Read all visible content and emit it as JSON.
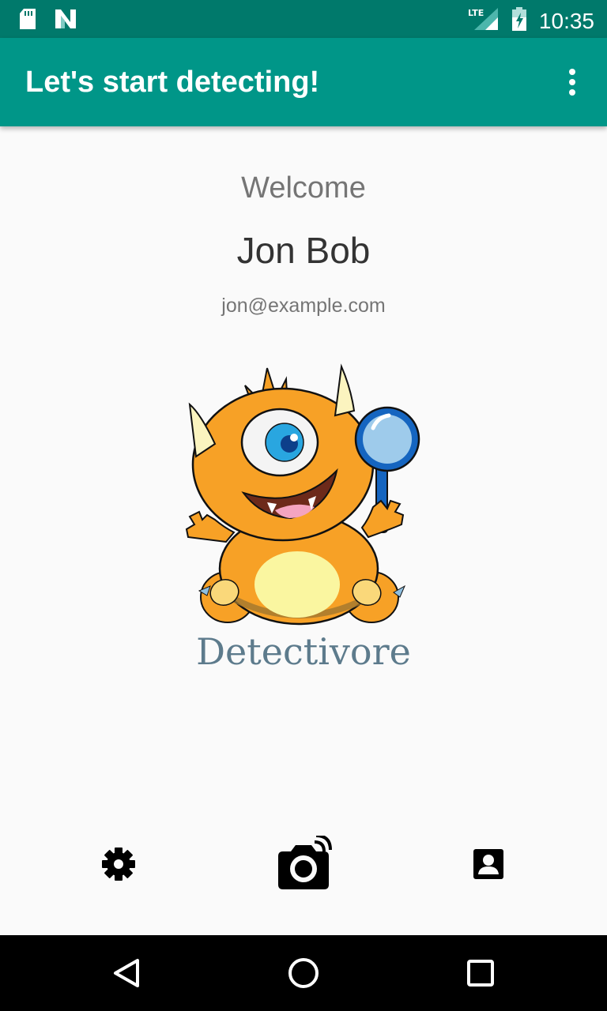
{
  "status_bar": {
    "time": "10:35",
    "network_label": "LTE",
    "icons": [
      "sd-card-icon",
      "n-notification-icon",
      "lte-signal-icon",
      "battery-charging-icon"
    ]
  },
  "app_bar": {
    "title": "Let's start detecting!",
    "menu_icon": "more-vert-icon"
  },
  "profile": {
    "welcome": "Welcome",
    "name": "Jon Bob",
    "email": "jon@example.com"
  },
  "brand": {
    "logo": "monster-detective-mascot",
    "name": "Detectivore"
  },
  "bottom_nav": {
    "items": [
      {
        "icon": "settings-gear-icon"
      },
      {
        "icon": "camera-icon"
      },
      {
        "icon": "account-box-icon"
      }
    ]
  },
  "system_nav": {
    "items": [
      {
        "icon": "back-triangle-icon"
      },
      {
        "icon": "home-circle-icon"
      },
      {
        "icon": "recents-square-icon"
      }
    ]
  },
  "colors": {
    "status_bar": "#00796b",
    "app_bar": "#009688",
    "background": "#fafafa",
    "brand_text": "#5d7b8c",
    "mascot_orange": "#f7a126"
  }
}
